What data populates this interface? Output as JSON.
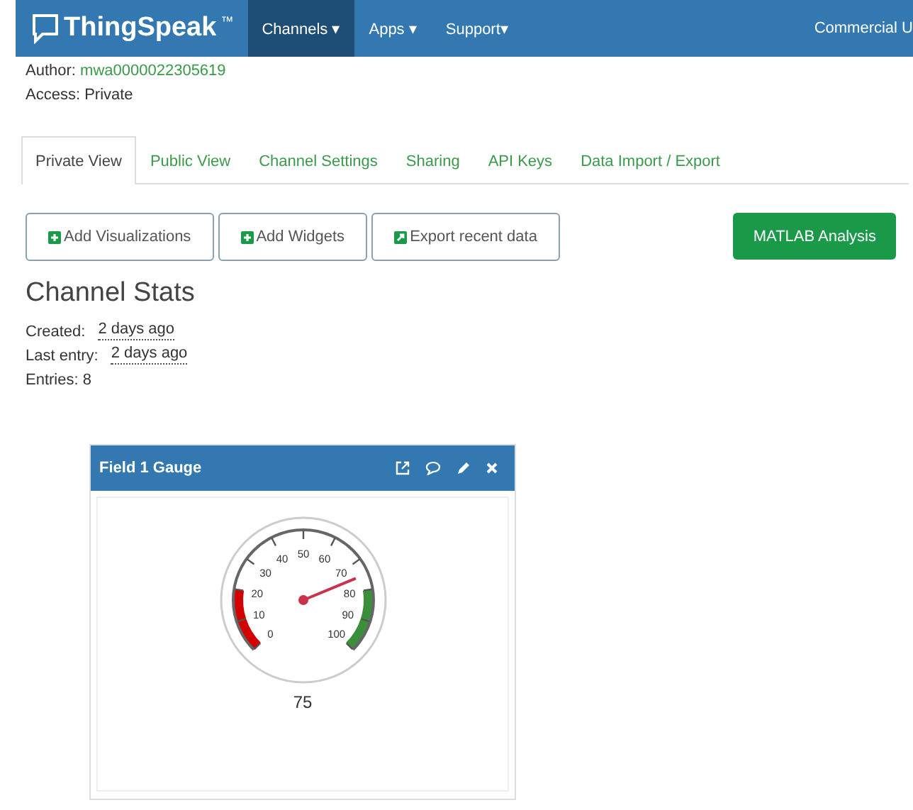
{
  "navbar": {
    "logo": "ThingSpeak",
    "trademark": "™",
    "menus": [
      {
        "label": "Channels ▾",
        "selected": true
      },
      {
        "label": "Apps ▾",
        "selected": false
      },
      {
        "label": "Support▾",
        "selected": false
      }
    ],
    "right_link": "Commercial U"
  },
  "channel_info": {
    "author_label": "Author:",
    "author": "mwa0000022305619",
    "access": "Access: Private"
  },
  "tabs": [
    {
      "label": "Private View",
      "selected": true
    },
    {
      "label": "Public View",
      "selected": false
    },
    {
      "label": "Channel Settings",
      "selected": false
    },
    {
      "label": "Sharing",
      "selected": false
    },
    {
      "label": "API Keys",
      "selected": false
    },
    {
      "label": "Data Import / Export",
      "selected": false
    }
  ],
  "actions": [
    {
      "label": "Add Visualizations",
      "kind": "plus"
    },
    {
      "label": "Add Widgets",
      "kind": "plus"
    },
    {
      "label": "Export recent data",
      "kind": "export"
    }
  ],
  "matlab_button": "MATLAB Analysis",
  "stats": {
    "title": "Channel Stats",
    "rows": [
      {
        "label": "Created:",
        "value": "2 days ago"
      },
      {
        "label": "Last entry:",
        "value": "2 days ago"
      }
    ],
    "entries": "Entries: 8"
  },
  "widget": {
    "title": "Field 1 Gauge",
    "ticks": [
      "0",
      "10",
      "20",
      "30",
      "40",
      "50",
      "60",
      "70",
      "80",
      "90",
      "100"
    ],
    "value": "75"
  }
}
